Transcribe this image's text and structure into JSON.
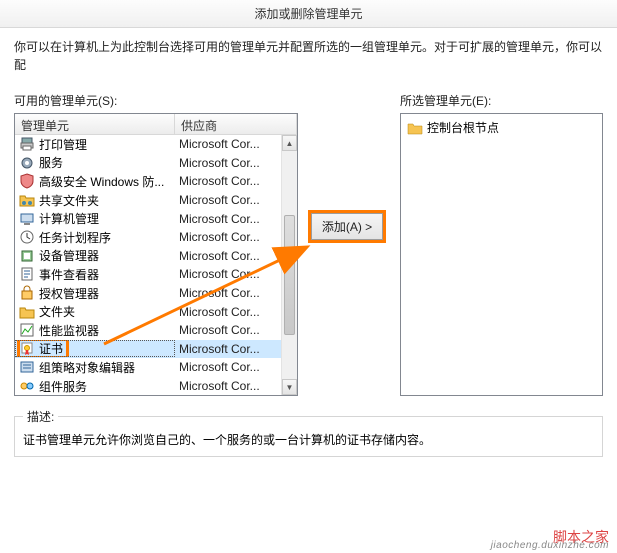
{
  "window": {
    "title": "添加或删除管理单元"
  },
  "instructions": "你可以在计算机上为此控制台选择可用的管理单元并配置所选的一组管理单元。对于可扩展的管理单元，你可以配",
  "available": {
    "label": "可用的管理单元(S):",
    "columns": {
      "name": "管理单元",
      "vendor": "供应商"
    },
    "items": [
      {
        "label": "打印管理",
        "vendor": "Microsoft Cor...",
        "icon": "printer"
      },
      {
        "label": "服务",
        "vendor": "Microsoft Cor...",
        "icon": "gear"
      },
      {
        "label": "高级安全 Windows 防...",
        "vendor": "Microsoft Cor...",
        "icon": "shield"
      },
      {
        "label": "共享文件夹",
        "vendor": "Microsoft Cor...",
        "icon": "shared-folder"
      },
      {
        "label": "计算机管理",
        "vendor": "Microsoft Cor...",
        "icon": "computer"
      },
      {
        "label": "任务计划程序",
        "vendor": "Microsoft Cor...",
        "icon": "clock"
      },
      {
        "label": "设备管理器",
        "vendor": "Microsoft Cor...",
        "icon": "device"
      },
      {
        "label": "事件查看器",
        "vendor": "Microsoft Cor...",
        "icon": "event"
      },
      {
        "label": "授权管理器",
        "vendor": "Microsoft Cor...",
        "icon": "auth"
      },
      {
        "label": "文件夹",
        "vendor": "Microsoft Cor...",
        "icon": "folder"
      },
      {
        "label": "性能监视器",
        "vendor": "Microsoft Cor...",
        "icon": "perf"
      },
      {
        "label": "证书",
        "vendor": "Microsoft Cor...",
        "icon": "cert",
        "selected": true
      },
      {
        "label": "组策略对象编辑器",
        "vendor": "Microsoft Cor...",
        "icon": "gpo"
      },
      {
        "label": "组件服务",
        "vendor": "Microsoft Cor...",
        "icon": "component"
      }
    ]
  },
  "selected": {
    "label": "所选管理单元(E):",
    "root": "控制台根节点"
  },
  "buttons": {
    "add": "添加(A) >"
  },
  "description": {
    "label": "描述:",
    "text": "证书管理单元允许你浏览自己的、一个服务的或一台计算机的证书存储内容。"
  },
  "watermark": "脚本之家",
  "watermark2": "jiaocheng.duxinzhe.com"
}
